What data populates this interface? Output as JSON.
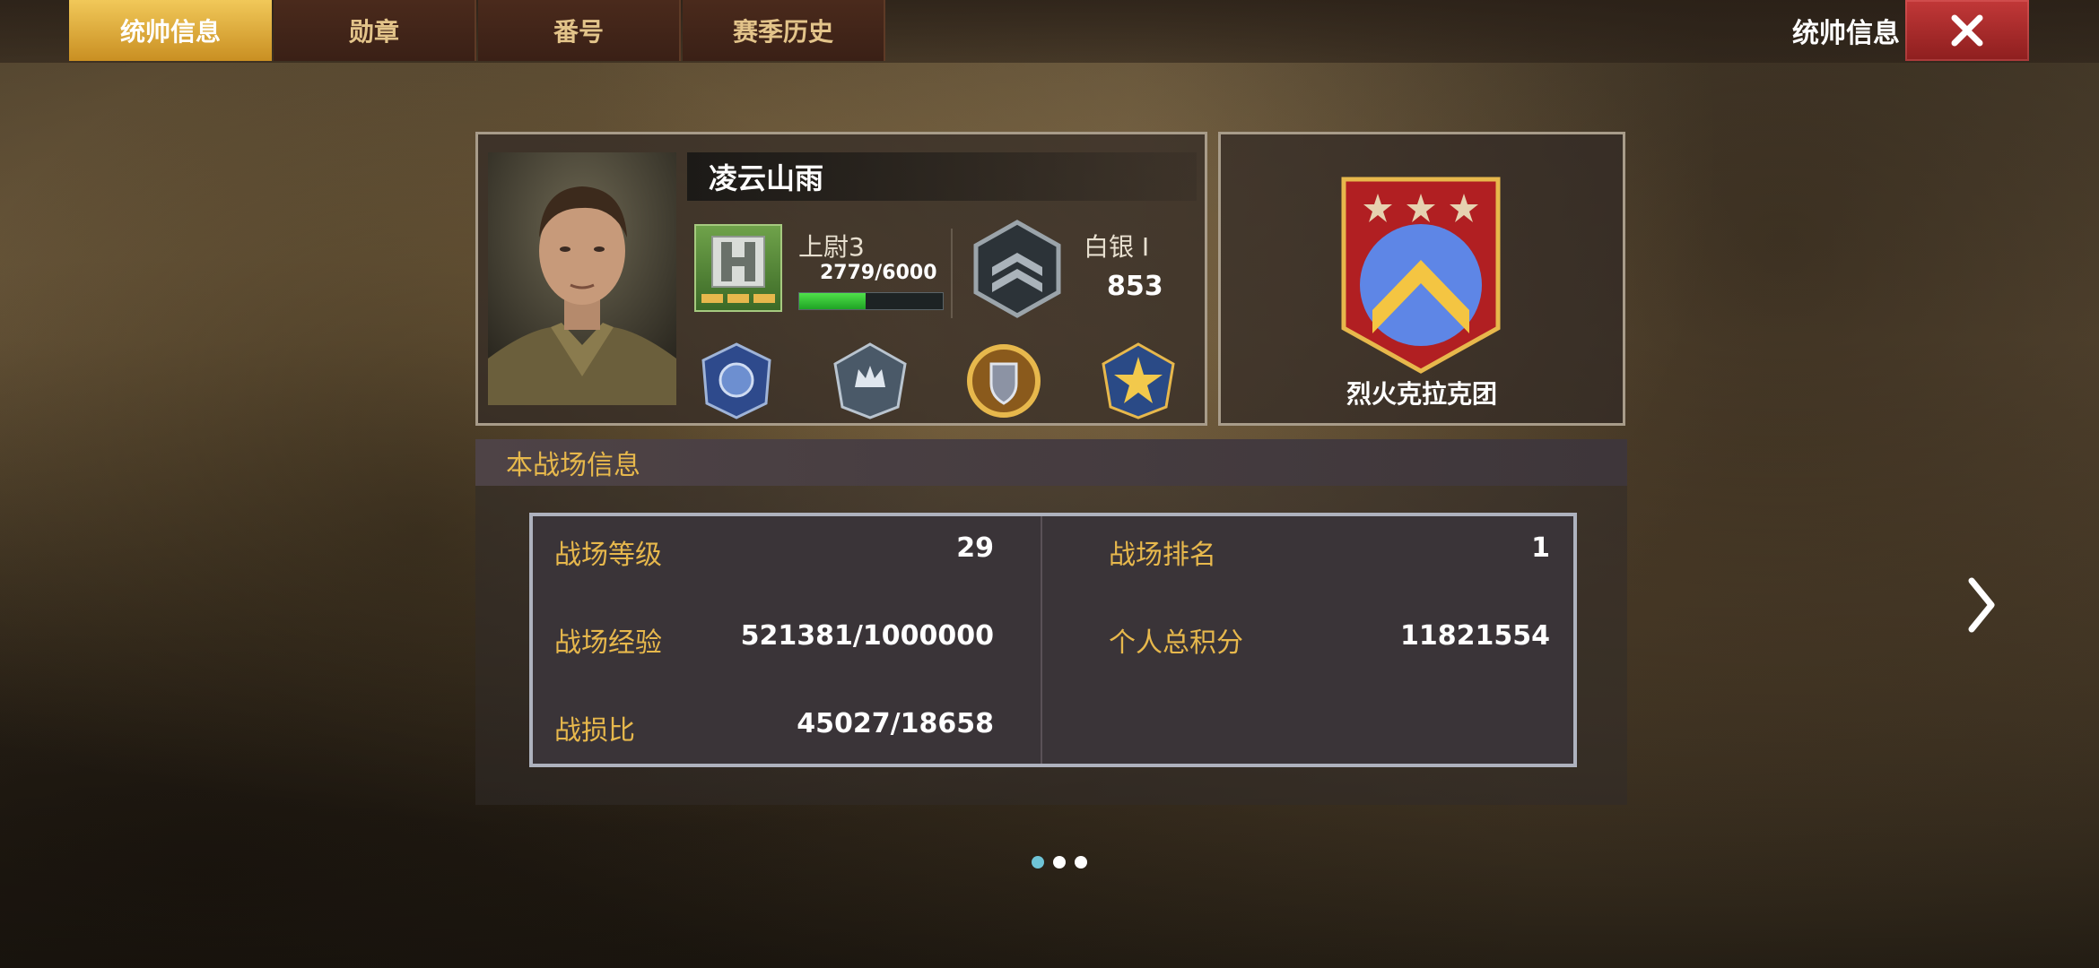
{
  "tabs": [
    {
      "label": "统帅信息",
      "active": true
    },
    {
      "label": "勋章",
      "active": false
    },
    {
      "label": "番号",
      "active": false
    },
    {
      "label": "赛季历史",
      "active": false
    }
  ],
  "header": {
    "title": "统帅信息"
  },
  "player": {
    "name": "凌云山雨",
    "rank": {
      "label": "上尉3",
      "xp": "2779/6000",
      "progress": 0.4632
    },
    "tier": {
      "label": "白银 I",
      "score": "853"
    }
  },
  "legion": {
    "name": "烈火克拉克团",
    "stars": 3
  },
  "battlefield": {
    "section_title": "本战场信息",
    "stats": [
      {
        "label": "战场等级",
        "value": "29"
      },
      {
        "label": "战场排名",
        "value": "1"
      },
      {
        "label": "战场经验",
        "value": "521381/1000000"
      },
      {
        "label": "个人总积分",
        "value": "11821554"
      },
      {
        "label": "战损比",
        "value": "45027/18658"
      }
    ]
  },
  "pagination": {
    "current": 1,
    "total": 3
  },
  "colors": {
    "accent_gold": "#e7b84c",
    "tab_active": "#f1c859",
    "close_red": "#c23838",
    "xp_green": "#4fe14a"
  }
}
